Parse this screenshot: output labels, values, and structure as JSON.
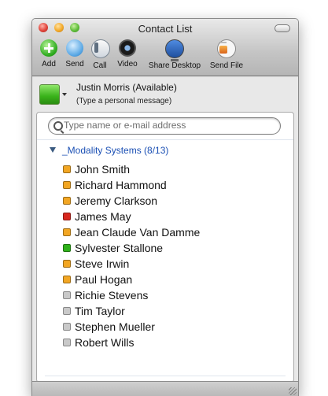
{
  "window": {
    "title": "Contact List"
  },
  "toolbar": {
    "items": [
      {
        "label": "Add",
        "icon": "add-icon"
      },
      {
        "label": "Send",
        "icon": "send-icon"
      },
      {
        "label": "Call",
        "icon": "call-icon"
      },
      {
        "label": "Video",
        "icon": "video-icon"
      },
      {
        "label": "Share Desktop",
        "icon": "share-desktop-icon"
      },
      {
        "label": "Send File",
        "icon": "send-file-icon"
      }
    ]
  },
  "self": {
    "name": "Justin Morris (Available)",
    "personal_message": "(Type a personal message)",
    "status": "available",
    "status_color": "#3cb521"
  },
  "search": {
    "placeholder": "Type name or e-mail address",
    "value": ""
  },
  "group": {
    "name": "_Modality Systems (8/13)",
    "expanded": true
  },
  "presence_colors": {
    "available": "#2fb11a",
    "away": "#f2a623",
    "busy": "#d7281f",
    "offline": "#c9c9c9"
  },
  "contacts": [
    {
      "name": "John Smith",
      "status": "away"
    },
    {
      "name": "Richard Hammond",
      "status": "away"
    },
    {
      "name": "Jeremy Clarkson",
      "status": "away"
    },
    {
      "name": "James May",
      "status": "busy"
    },
    {
      "name": "Jean Claude Van Damme",
      "status": "away"
    },
    {
      "name": "Sylvester Stallone",
      "status": "available"
    },
    {
      "name": "Steve Irwin",
      "status": "away"
    },
    {
      "name": "Paul Hogan",
      "status": "away"
    },
    {
      "name": "Richie Stevens",
      "status": "offline"
    },
    {
      "name": "Tim Taylor",
      "status": "offline"
    },
    {
      "name": "Stephen Mueller",
      "status": "offline"
    },
    {
      "name": "Robert Wills",
      "status": "offline"
    }
  ]
}
